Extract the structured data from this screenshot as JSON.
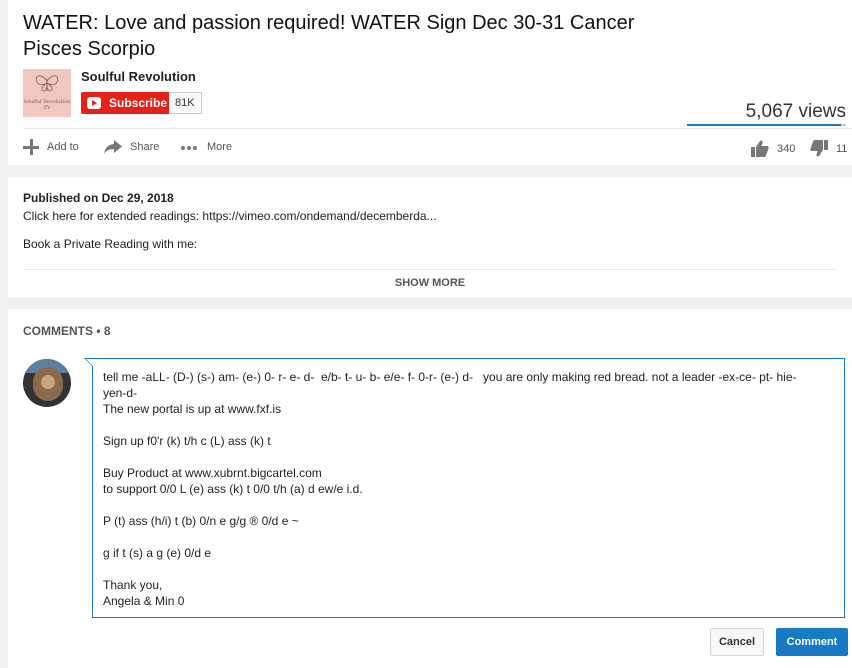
{
  "video": {
    "title": "WATER: Love and passion required! WATER Sign Dec 30-31 Cancer Pisces Scorpio",
    "channel": {
      "name": "Soulful Revolution",
      "logo_text": "Soulful Revolution TV",
      "subscribe_label": "Subscribe",
      "subscriber_count": "81K"
    },
    "views": "5,067 views",
    "like_ratio": 0.969,
    "actions": {
      "add_to": "Add to",
      "share": "Share",
      "more": "More"
    },
    "likes": "340",
    "dislikes": "11"
  },
  "description": {
    "published": "Published on Dec 29, 2018",
    "line1": "Click here for extended readings: https://vimeo.com/ondemand/decemberda...",
    "line2": "Book a Private Reading with me:",
    "show_more": "SHOW MORE"
  },
  "comments": {
    "header": "COMMENTS • 8",
    "draft": "tell me -aLL- (D-) (s-) am- (e-) 0- r- e- d-  e/b- t- u- b- e/e- f- 0-r- (e-) d-   you are only making red bread. not a leader -ex-ce- pt- hie-\nyen-d-\nThe new portal is up at www.fxf.is\n\nSign up f0'r (k) t/h c (L) ass (k) t\n\nBuy Product at www.xubrnt.bigcartel.com\nto support 0/0 L (e) ass (k) t 0/0 t/h (a) d ew/e i.d.\n\nP (t) ass (h/i) t (b) 0/n e g/g ® 0/d e ~\n\ng if t (s) a g (e) 0/d e\n\nThank you,\nAngela & Min 0",
    "cancel_label": "Cancel",
    "submit_label": "Comment"
  },
  "colors": {
    "accent": "#167ac6",
    "subscribe": "#e62117"
  }
}
